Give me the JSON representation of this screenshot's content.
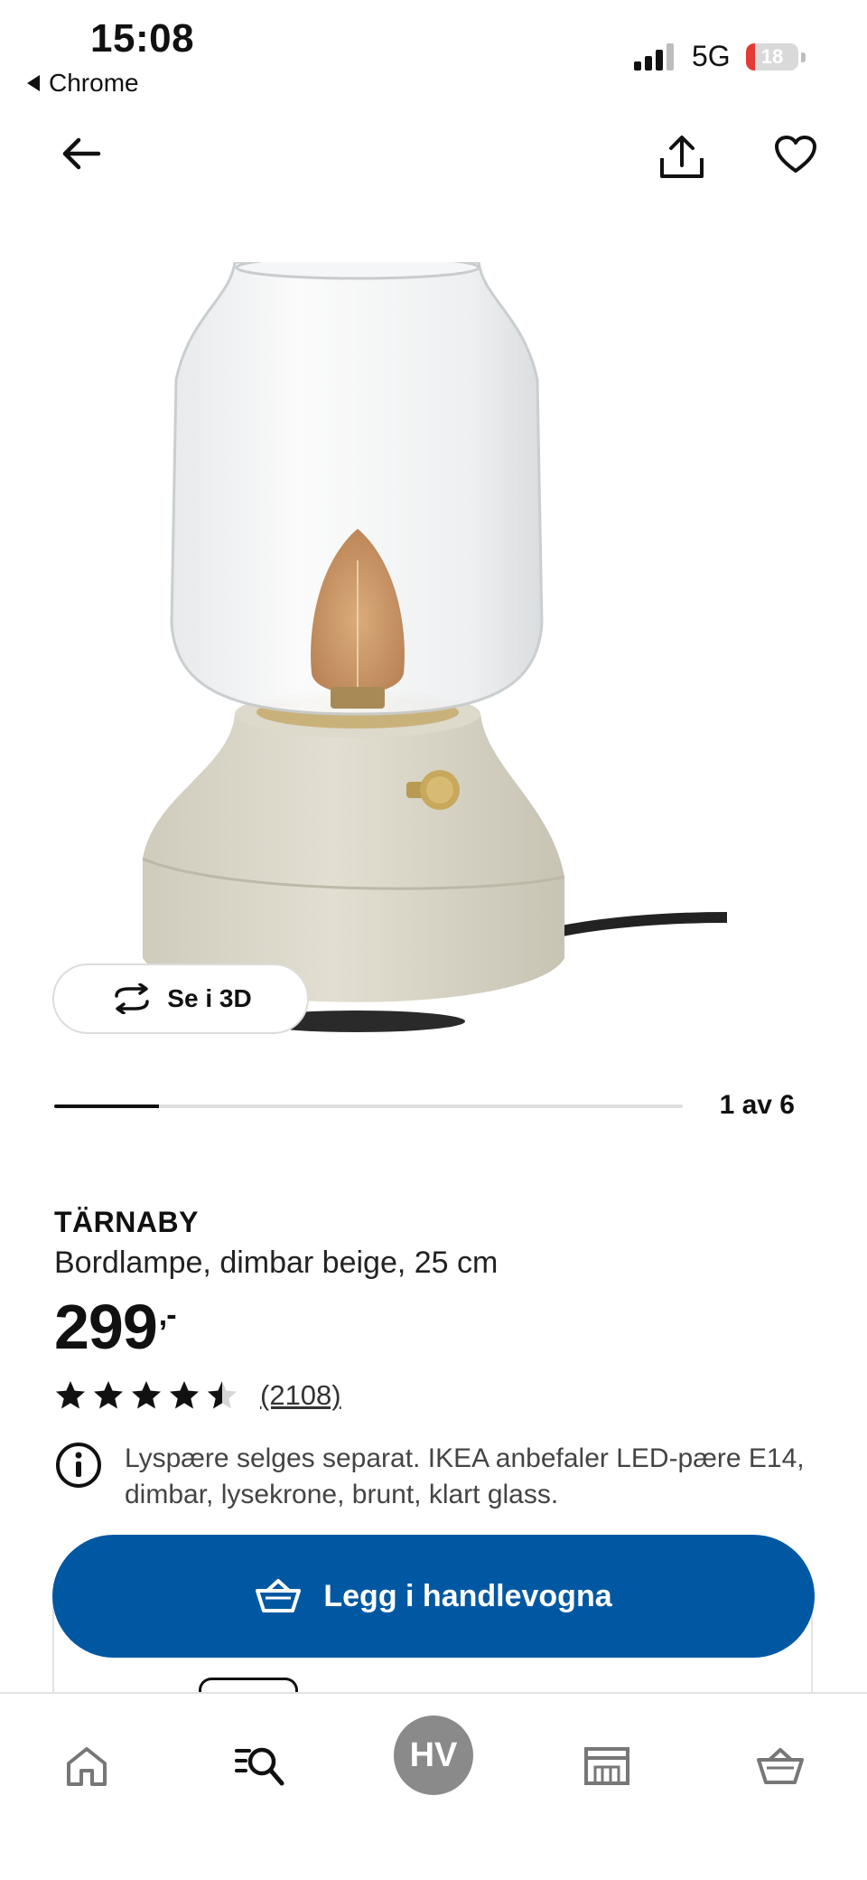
{
  "status_bar": {
    "time": "15:08",
    "back_app": "Chrome",
    "network": "5G",
    "battery": "18",
    "battery_level": 0.18
  },
  "top_bar": {
    "back_icon": "arrow-left-icon",
    "share_icon": "share-icon",
    "favorite_icon": "heart-icon"
  },
  "gallery": {
    "view_3d_label": "Se i 3D",
    "pager": "1 av 6",
    "current": 1,
    "total": 6
  },
  "product": {
    "name": "TÄRNABY",
    "description": "Bordlampe, dimbar beige, 25 cm",
    "price": "299",
    "price_suffix": ",-",
    "rating": 4.5,
    "rating_max": 5,
    "review_count": "(2108)",
    "notice": "Lyspære selges separat. IKEA anbefaler LED-pære E14, dimbar, lysekrone, brunt, klart glass."
  },
  "actions": {
    "add_to_cart": "Legg i handlevogna"
  },
  "bottom_nav": {
    "items": [
      "home-icon",
      "search-icon",
      "profile-avatar",
      "store-icon",
      "cart-icon"
    ],
    "avatar_initials": "HV"
  },
  "colors": {
    "accent": "#0058a3",
    "battery_low": "#e53935",
    "text": "#111111"
  }
}
